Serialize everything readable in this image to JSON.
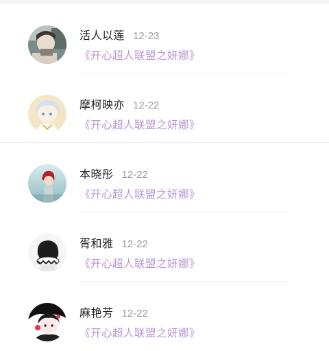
{
  "comments": [
    {
      "user": "活人以莲",
      "date": "12-23",
      "book": "《开心超人联盟之妍娜》",
      "avatar_icon": "anime-avatar-boy-photo-icon"
    },
    {
      "user": "摩柯映亦",
      "date": "12-22",
      "book": "《开心超人联盟之妍娜》",
      "avatar_icon": "anime-avatar-white-hair-icon"
    },
    {
      "user": "本晓彤",
      "date": "12-22",
      "book": "《开心超人联盟之妍娜》",
      "avatar_icon": "anime-avatar-red-hair-icon"
    },
    {
      "user": "胥和雅",
      "date": "12-22",
      "book": "《开心超人联盟之妍娜》",
      "avatar_icon": "anime-avatar-dark-hair-icon"
    },
    {
      "user": "麻艳芳",
      "date": "12-22",
      "book": "《开心超人联盟之妍娜》",
      "avatar_icon": "anime-avatar-girl-icon"
    }
  ],
  "colors": {
    "book_link": "#b793d6",
    "date": "#9a9a9a",
    "name": "#222222",
    "divider": "#ececec"
  }
}
